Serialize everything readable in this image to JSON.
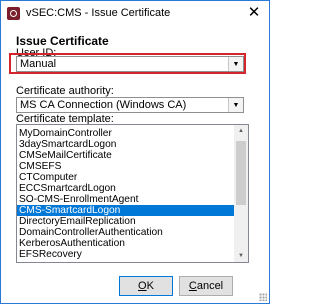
{
  "window": {
    "title": "vSEC:CMS - Issue Certificate",
    "close_glyph": "✕"
  },
  "section_title": "Issue Certificate",
  "user_id": {
    "label": "User ID:",
    "value": "Manual"
  },
  "certificate_authority": {
    "label": "Certificate authority:",
    "value": "MS CA Connection (Windows CA)"
  },
  "certificate_template": {
    "label": "Certificate template:",
    "items": [
      "MyDomainController",
      "3daySmartcardLogon",
      "CMSeMailCertificate",
      "CMSEFS",
      "CTComputer",
      "ECCSmartcardLogon",
      "SO-CMS-EnrollmentAgent",
      "CMS-SmartcardLogon",
      "DirectoryEmailReplication",
      "DomainControllerAuthentication",
      "KerberosAuthentication",
      "EFSRecovery"
    ],
    "selected": "CMS-SmartcardLogon"
  },
  "buttons": {
    "ok_mnemonic": "O",
    "ok_rest": "K",
    "cancel_mnemonic": "C",
    "cancel_rest": "ancel"
  },
  "icons": {
    "app": "vsec-app-icon",
    "dropdown": "chevron-down-icon",
    "scroll_up": "scroll-up-arrow-icon",
    "scroll_down": "scroll-down-arrow-icon"
  },
  "colors": {
    "highlight_border": "#d3252c",
    "selection": "#0078d7",
    "window_border": "#2b79d7"
  }
}
